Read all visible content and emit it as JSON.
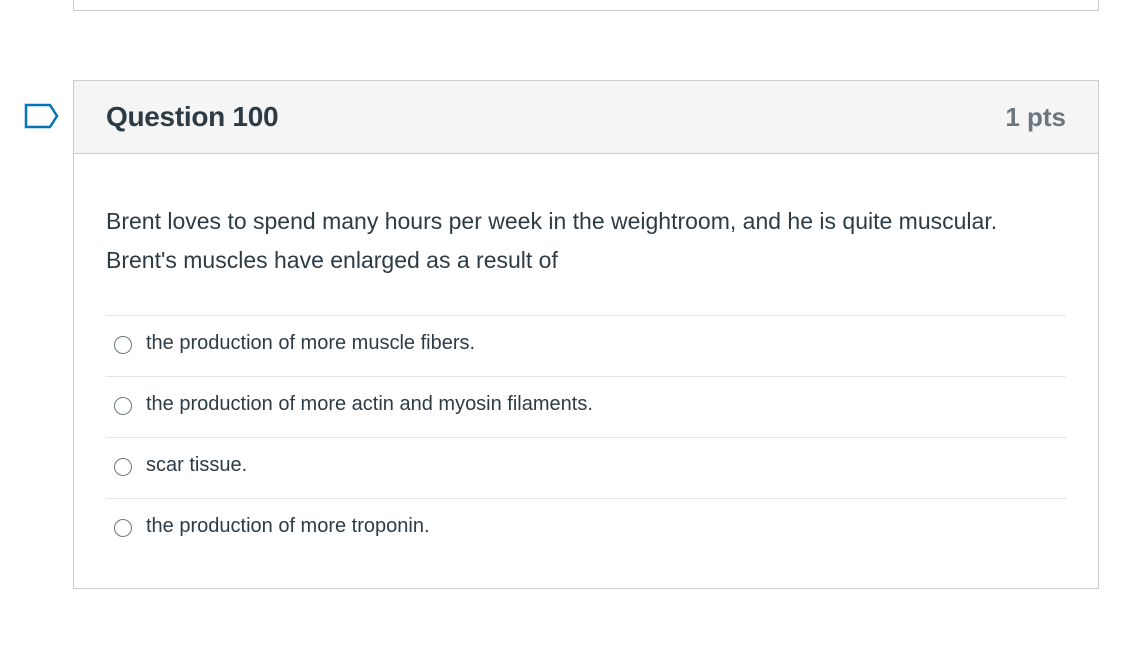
{
  "question": {
    "title": "Question 100",
    "points": "1 pts",
    "text": "Brent loves to spend many hours per week in the weightroom, and he is quite muscular. Brent's muscles have enlarged as a result of",
    "answers": [
      {
        "label": "the production of more muscle fibers."
      },
      {
        "label": "the production of more actin and myosin filaments."
      },
      {
        "label": "scar tissue."
      },
      {
        "label": "the production of more troponin."
      }
    ]
  },
  "colors": {
    "flag": "#0374b5",
    "header_bg": "#f5f5f5",
    "border": "#c7cdd1",
    "text": "#2d3b45",
    "points_text": "#6b7780"
  },
  "icons": {
    "flag": "bookmark-flag-icon"
  }
}
